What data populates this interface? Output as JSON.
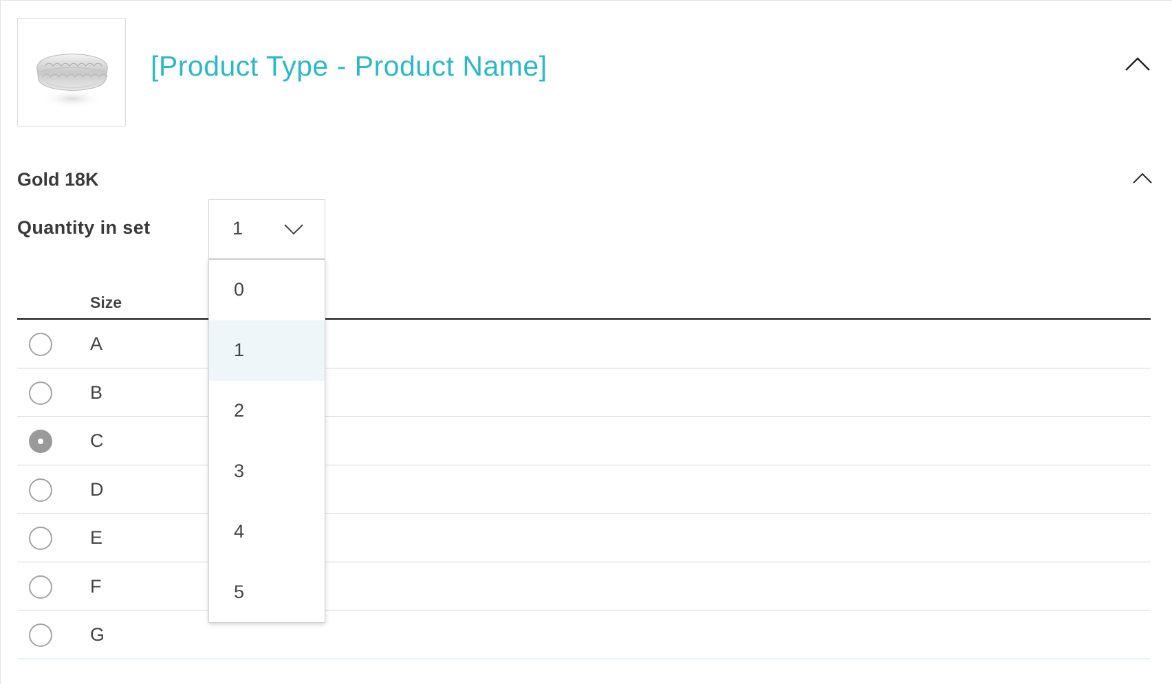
{
  "header": {
    "product_title": "[Product Type - Product Name]",
    "title_color": "#2bb9c8",
    "collapse_icon": "chevron-up-icon",
    "thumbnail_icon": "ring-image"
  },
  "section": {
    "title": "Gold 18K",
    "collapse_icon": "chevron-up-icon"
  },
  "quantity": {
    "label": "Quantity in set",
    "selected": "1",
    "dropdown_icon": "chevron-down-icon",
    "options": [
      "0",
      "1",
      "2",
      "3",
      "4",
      "5"
    ],
    "highlighted_option": "1"
  },
  "size_table": {
    "header": "Size",
    "rows": [
      {
        "label": "A",
        "selected": false
      },
      {
        "label": "B",
        "selected": false
      },
      {
        "label": "C",
        "selected": true
      },
      {
        "label": "D",
        "selected": false
      },
      {
        "label": "E",
        "selected": false
      },
      {
        "label": "F",
        "selected": false
      },
      {
        "label": "G",
        "selected": false
      }
    ]
  }
}
